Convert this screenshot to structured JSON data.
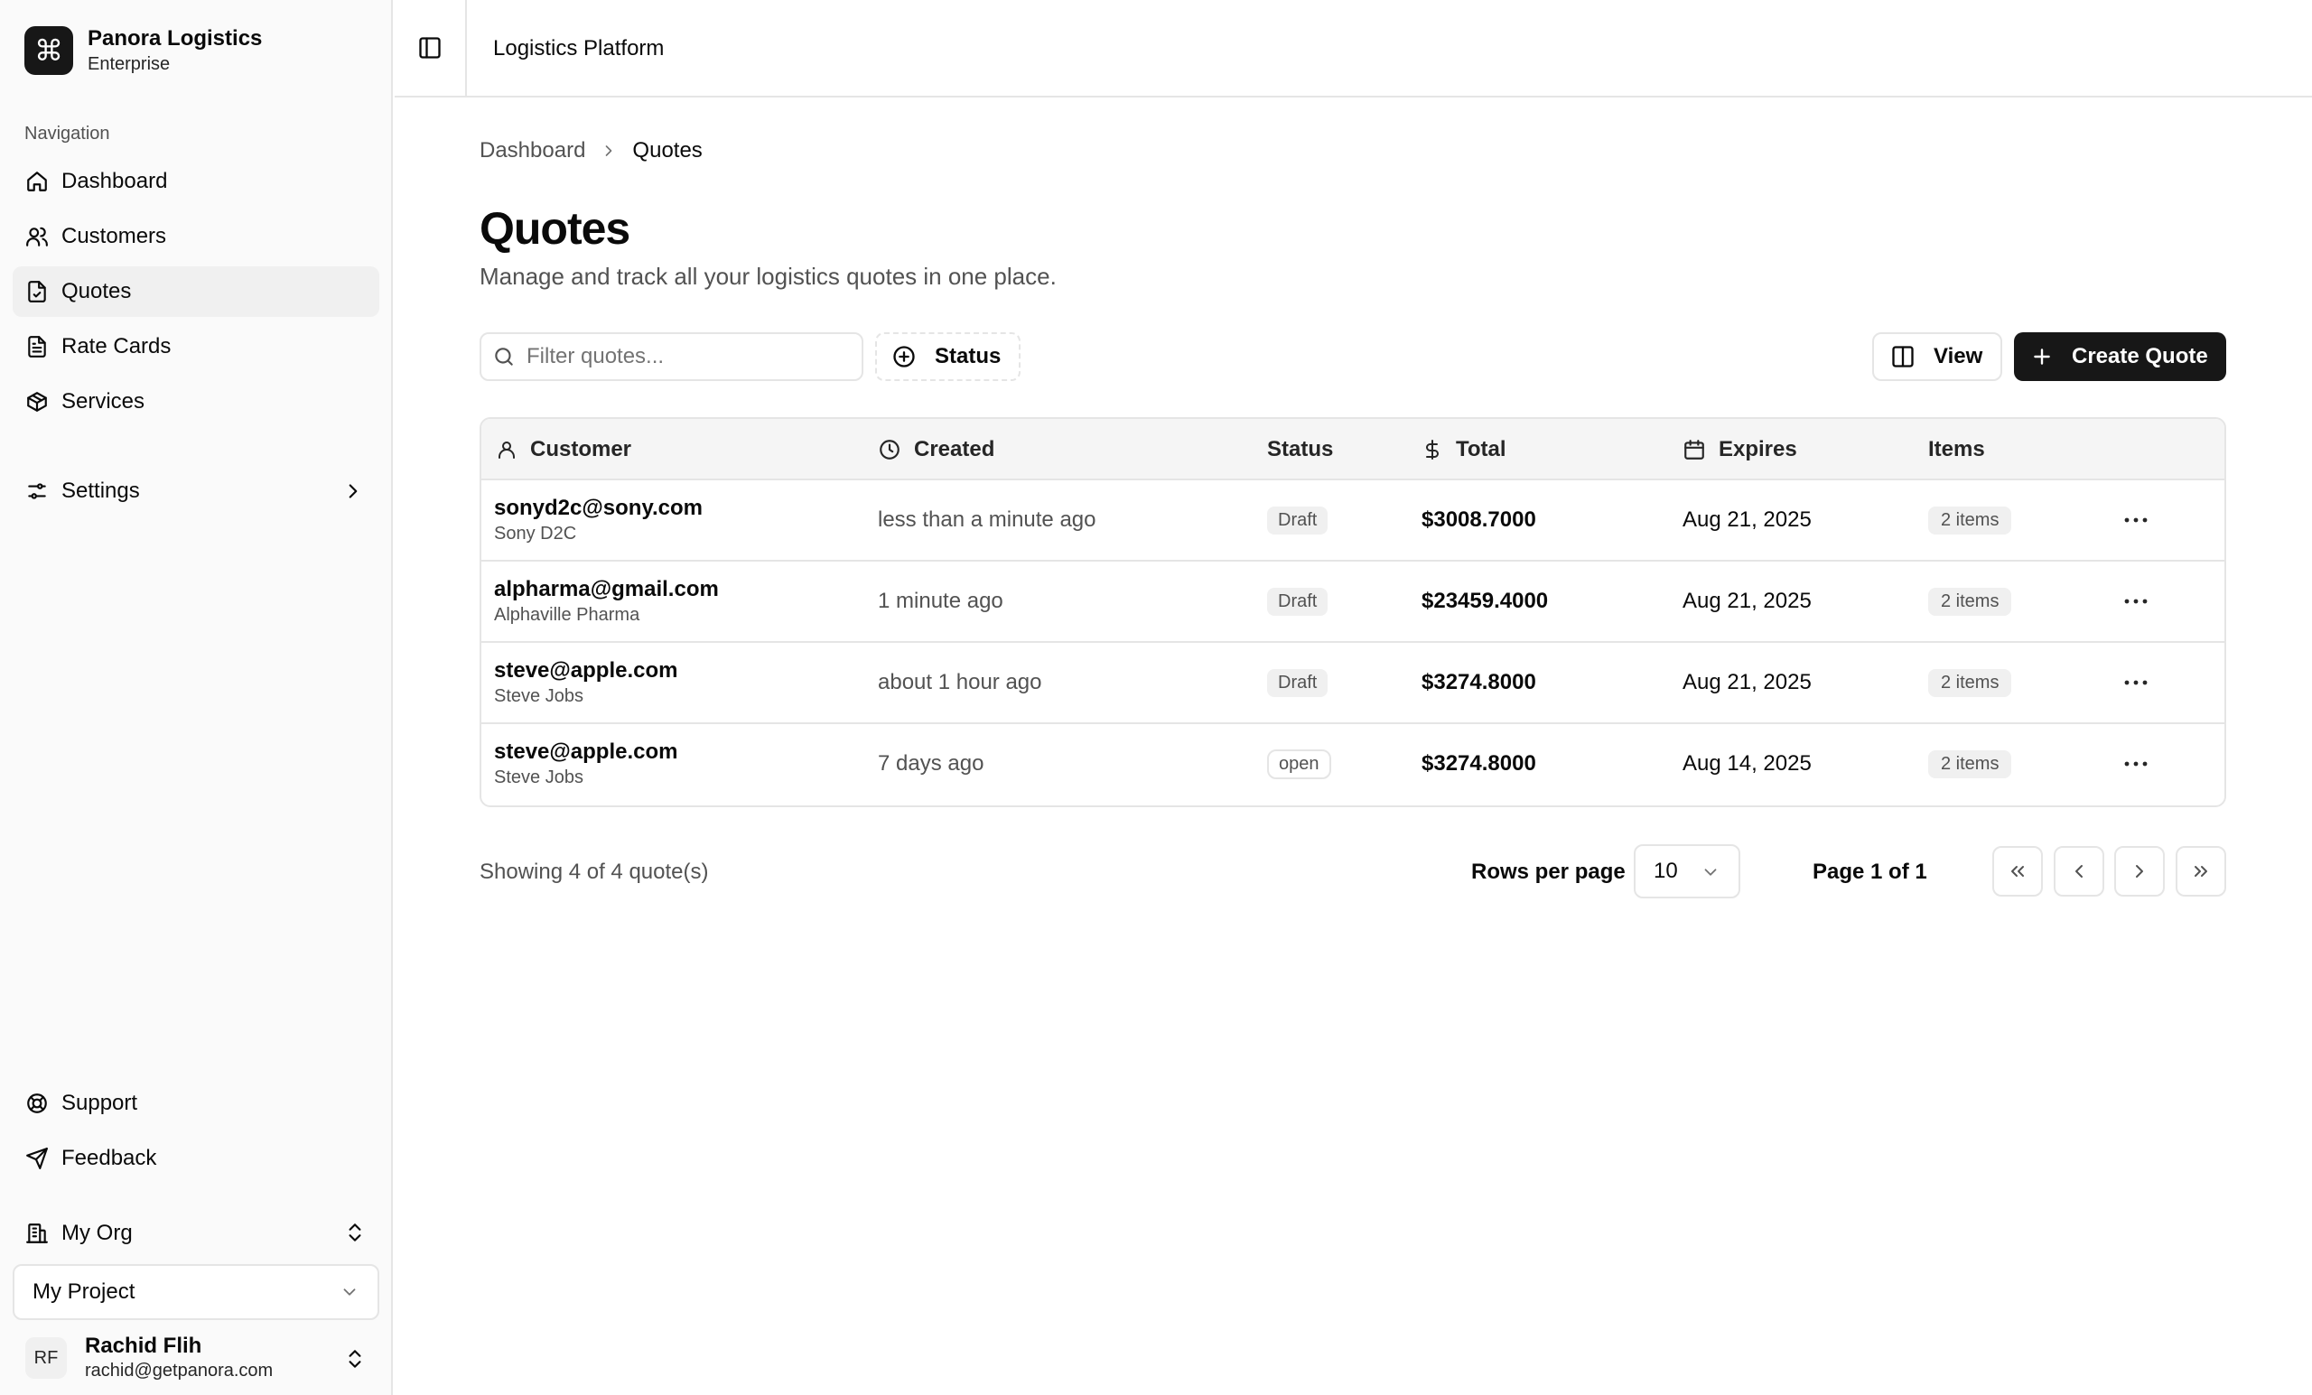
{
  "brand": {
    "name": "Panora Logistics",
    "plan": "Enterprise",
    "logo_glyph": "⌘"
  },
  "sidebar": {
    "section_label": "Navigation",
    "items": [
      {
        "label": "Dashboard",
        "icon": "home-icon"
      },
      {
        "label": "Customers",
        "icon": "users-icon"
      },
      {
        "label": "Quotes",
        "icon": "file-check-icon",
        "active": true
      },
      {
        "label": "Rate Cards",
        "icon": "file-text-icon"
      },
      {
        "label": "Services",
        "icon": "package-icon"
      }
    ],
    "settings_label": "Settings",
    "bottom_items": [
      {
        "label": "Support",
        "icon": "life-buoy-icon"
      },
      {
        "label": "Feedback",
        "icon": "send-icon"
      }
    ],
    "org_label": "My Org",
    "project_label": "My Project",
    "user": {
      "initials": "RF",
      "name": "Rachid Flih",
      "email": "rachid@getpanora.com"
    }
  },
  "header": {
    "title": "Logistics Platform"
  },
  "breadcrumb": {
    "parent": "Dashboard",
    "current": "Quotes"
  },
  "page": {
    "title": "Quotes",
    "subtitle": "Manage and track all your logistics quotes in one place."
  },
  "toolbar": {
    "search_placeholder": "Filter quotes...",
    "status_label": "Status",
    "view_label": "View",
    "create_label": "Create Quote"
  },
  "table": {
    "headers": {
      "customer": "Customer",
      "created": "Created",
      "status": "Status",
      "total": "Total",
      "expires": "Expires",
      "items": "Items"
    },
    "rows": [
      {
        "email": "sonyd2c@sony.com",
        "name": "Sony D2C",
        "created": "less than a minute ago",
        "status": "Draft",
        "total": "$3008.7000",
        "expires": "Aug 21, 2025",
        "items": "2 items"
      },
      {
        "email": "alpharma@gmail.com",
        "name": "Alphaville Pharma",
        "created": "1 minute ago",
        "status": "Draft",
        "total": "$23459.4000",
        "expires": "Aug 21, 2025",
        "items": "2 items"
      },
      {
        "email": "steve@apple.com",
        "name": "Steve Jobs",
        "created": "about 1 hour ago",
        "status": "Draft",
        "total": "$3274.8000",
        "expires": "Aug 21, 2025",
        "items": "2 items"
      },
      {
        "email": "steve@apple.com",
        "name": "Steve Jobs",
        "created": "7 days ago",
        "status": "open",
        "total": "$3274.8000",
        "expires": "Aug 14, 2025",
        "items": "2 items"
      }
    ]
  },
  "pagination": {
    "showing": "Showing 4 of 4 quote(s)",
    "rows_per_page_label": "Rows per page",
    "rows_per_page_value": "10",
    "page_info": "Page 1 of 1"
  },
  "colors": {
    "primary": "#171717",
    "border": "#e5e5e5",
    "muted_text": "#525252",
    "sidebar_bg": "#fafafa"
  }
}
